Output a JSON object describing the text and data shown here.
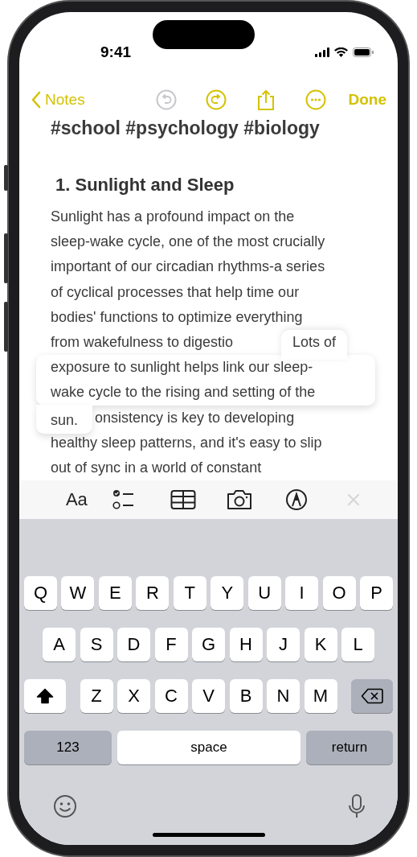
{
  "status_bar": {
    "time": "9:41"
  },
  "nav": {
    "back": "Notes",
    "done": "Done",
    "actions": [
      {
        "kind": "undo",
        "disabled": true
      },
      {
        "kind": "redo",
        "disabled": false
      },
      {
        "kind": "share",
        "disabled": false
      },
      {
        "kind": "more",
        "disabled": false
      }
    ]
  },
  "note": {
    "tags": "#school #psychology #biology",
    "heading": "1. Sunlight and Sleep",
    "lines": [
      {
        "kind": "plain",
        "text": "Sunlight has a profound impact on the"
      },
      {
        "kind": "plain",
        "text": "sleep-wake cycle, one of the most crucially"
      },
      {
        "kind": "plain",
        "text": "important of our circadian rhythms-a series"
      },
      {
        "kind": "plain",
        "text": "of cyclical processes that help time our"
      },
      {
        "kind": "plain",
        "text": "bodies' functions to optimize everything"
      },
      {
        "kind": "plain",
        "text": "from wakefulness to digestio"
      },
      {
        "kind": "lifted"
      },
      {
        "kind": "tail",
        "text": "onsistency is key to developing"
      },
      {
        "kind": "plain",
        "text": "healthy sleep patterns, and it's easy to slip"
      },
      {
        "kind": "plain",
        "text": "out of sync in a world of constant"
      }
    ],
    "lifted_text": {
      "first": "Lots of",
      "middle": [
        "exposure to sunlight helps link our sleep-",
        "wake cycle to the rising and setting of the"
      ],
      "last": "sun."
    }
  },
  "format_bar": [
    {
      "kind": "text-style",
      "label": "Aa",
      "disabled": false
    },
    {
      "kind": "checklist",
      "disabled": false
    },
    {
      "kind": "table",
      "disabled": false
    },
    {
      "kind": "camera",
      "disabled": false
    },
    {
      "kind": "markup",
      "disabled": false
    },
    {
      "kind": "close",
      "disabled": true
    }
  ],
  "keyboard": {
    "rows": [
      [
        "Q",
        "W",
        "E",
        "R",
        "T",
        "Y",
        "U",
        "I",
        "O",
        "P"
      ],
      [
        "A",
        "S",
        "D",
        "F",
        "G",
        "H",
        "J",
        "K",
        "L"
      ],
      [
        "Z",
        "X",
        "C",
        "V",
        "B",
        "N",
        "M"
      ]
    ],
    "shift_on": true,
    "numbers": "123",
    "space": "space",
    "return": "return"
  }
}
